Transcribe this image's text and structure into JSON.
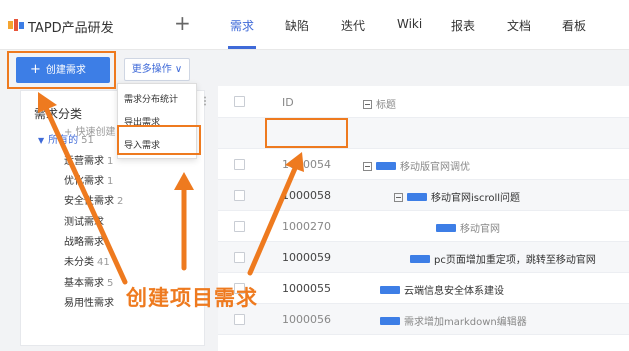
{
  "header": {
    "project_title": "TAPD产品研发",
    "add_label": "+",
    "tabs": [
      {
        "label": "需求",
        "active": true
      },
      {
        "label": "缺陷"
      },
      {
        "label": "迭代"
      },
      {
        "label": "Wiki"
      },
      {
        "label": "报表"
      },
      {
        "label": "文档"
      },
      {
        "label": "看板"
      }
    ]
  },
  "toolbar": {
    "create_label": "创建需求",
    "more_label": "更多操作 ∨"
  },
  "dropdown": {
    "items": [
      "需求分布统计",
      "导出需求",
      "导入需求"
    ]
  },
  "sidebar": {
    "title": "需求分类",
    "all": {
      "label": "所有的",
      "count": "51"
    },
    "items": [
      {
        "label": "运营需求",
        "count": "1"
      },
      {
        "label": "优化需求",
        "count": "1"
      },
      {
        "label": "安全性需求",
        "count": "2"
      },
      {
        "label": "测试需求",
        "count": ""
      },
      {
        "label": "战略需求",
        "count": ""
      },
      {
        "label": "未分类",
        "count": "41"
      },
      {
        "label": "基本需求",
        "count": "5"
      },
      {
        "label": "易用性需求",
        "count": ""
      }
    ]
  },
  "table": {
    "header_id": "ID",
    "header_title": "标题",
    "quick_create": "+ 快速创建",
    "rows": [
      {
        "id": "1000054",
        "title": "移动版官网调优"
      },
      {
        "id": "1000058",
        "title": "移动官网iscroll问题"
      },
      {
        "id": "1000270",
        "title": "移动官网"
      },
      {
        "id": "1000059",
        "title": "pc页面增加重定项，跳转至移动官网"
      },
      {
        "id": "1000055",
        "title": "云端信息安全体系建设"
      },
      {
        "id": "1000056",
        "title": "需求增加markdown编辑器"
      }
    ]
  },
  "annotation": {
    "text": "创建项目需求",
    "color": "#ee7a1f"
  },
  "colors": {
    "accent": "#3f6ad8",
    "button": "#3d7ee6"
  }
}
